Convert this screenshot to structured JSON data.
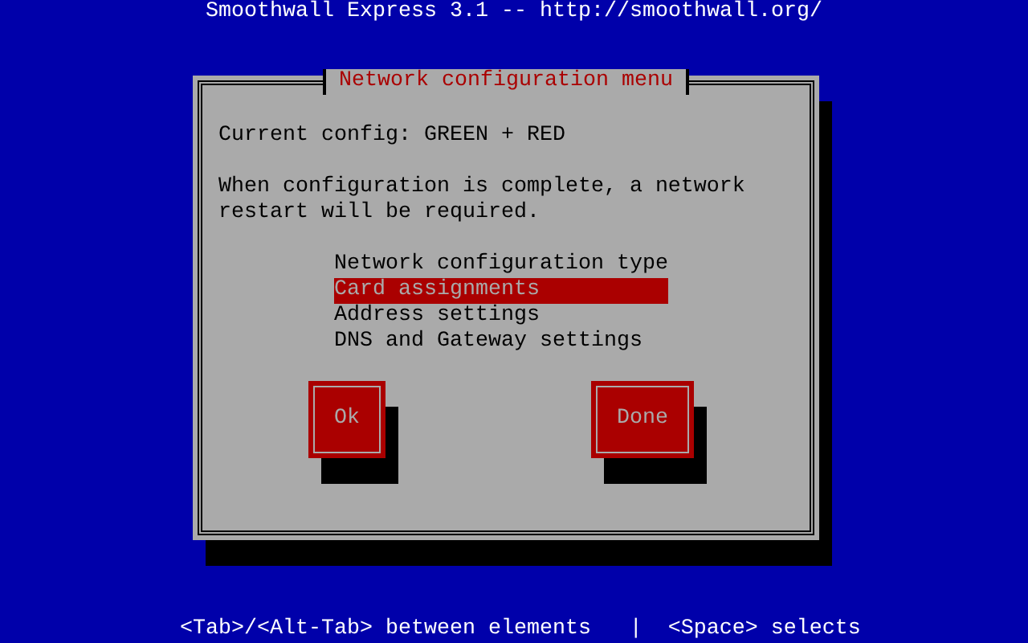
{
  "screen_title": "Smoothwall Express 3.1 -- http://smoothwall.org/",
  "dialog": {
    "title": "Network configuration menu",
    "current_config": "Current config: GREEN + RED",
    "message": "When configuration is complete, a network restart will be required.",
    "menu_items": [
      {
        "label": "Network configuration type",
        "selected": false
      },
      {
        "label": "Card assignments",
        "selected": true
      },
      {
        "label": "Address settings",
        "selected": false
      },
      {
        "label": "DNS and Gateway settings",
        "selected": false
      }
    ],
    "buttons": [
      {
        "label": "Ok"
      },
      {
        "label": "Done"
      }
    ]
  },
  "help_line": "<Tab>/<Alt-Tab> between elements   |  <Space> selects"
}
